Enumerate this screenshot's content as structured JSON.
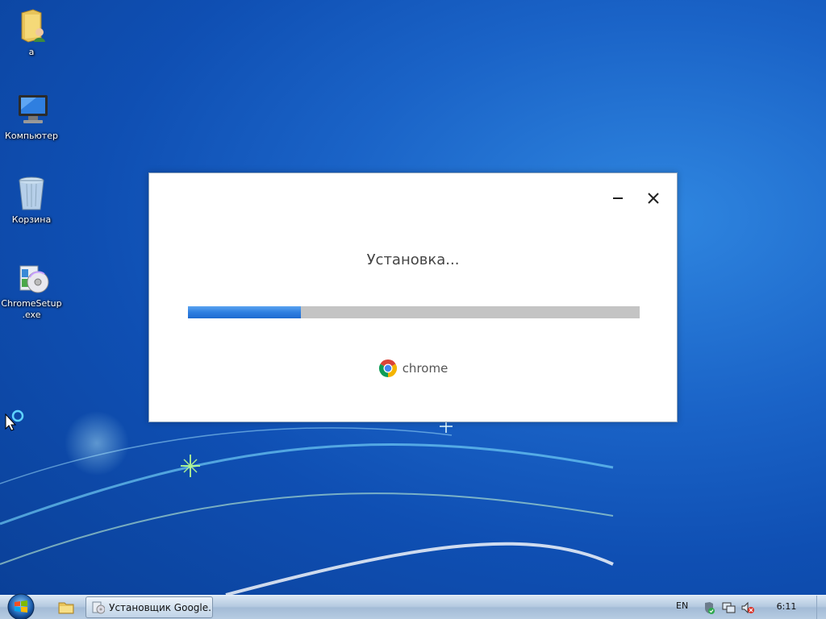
{
  "desktop": {
    "icons": [
      {
        "label": "a",
        "icon": "user-folder-icon"
      },
      {
        "label": "Компьютер",
        "icon": "computer-icon"
      },
      {
        "label": "Корзина",
        "icon": "recycle-bin-icon"
      },
      {
        "label_line1": "ChromeSetup",
        "label_line2": ".exe",
        "icon": "installer-icon"
      }
    ]
  },
  "dialog": {
    "status_text": "Установка...",
    "progress_fraction": 0.25,
    "brand_text": "chrome",
    "minimize_icon": "minimize-icon",
    "close_icon": "close-icon"
  },
  "taskbar": {
    "start_icon": "windows-start-icon",
    "pinned_icon": "explorer-folder-icon",
    "task_label": "Установщик Google...",
    "language": "EN",
    "clock": "6:11",
    "tray_icons": [
      "security-shield-icon",
      "network-icon",
      "volume-muted-icon"
    ]
  },
  "colors": {
    "progress_fill": "#2f7fe0",
    "progress_track": "#c4c4c4",
    "desktop_blue": "#1a63c7"
  }
}
